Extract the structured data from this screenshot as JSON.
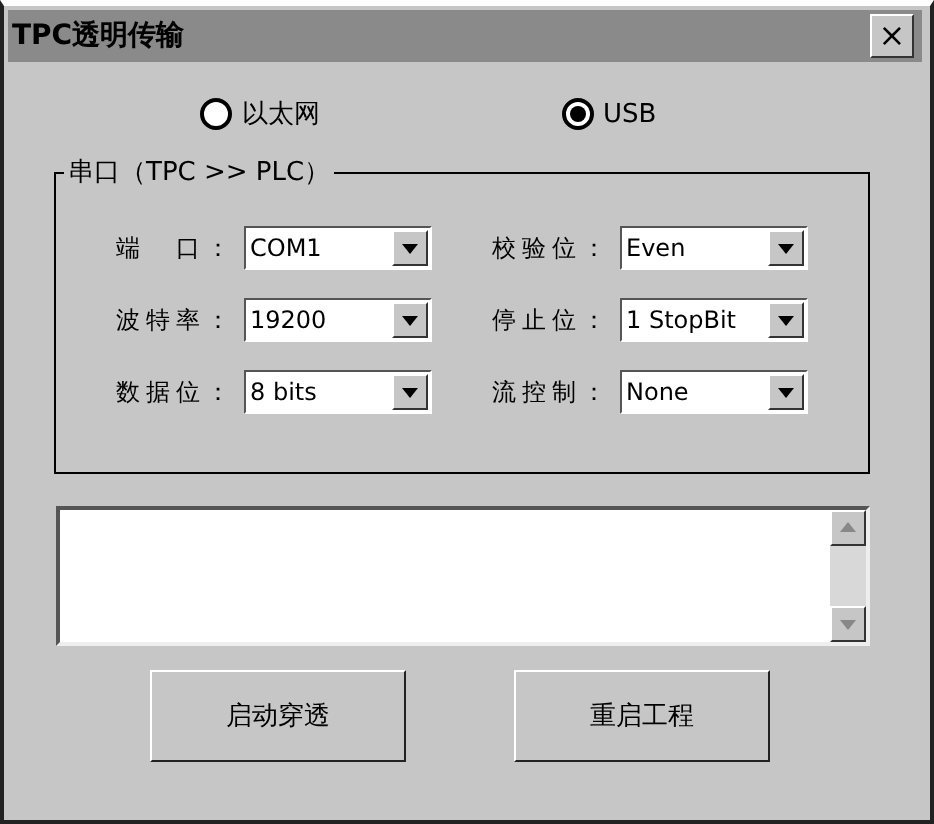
{
  "window": {
    "title": "TPC透明传输",
    "close": "×"
  },
  "connection": [
    {
      "label": "以太网",
      "selected": false
    },
    {
      "label": "USB",
      "selected": true
    }
  ],
  "group": {
    "title": "串口（TPC >> PLC）",
    "fields": [
      {
        "label": "端　口：",
        "value": "COM1"
      },
      {
        "label": "校验位：",
        "value": "Even"
      },
      {
        "label": "波特率：",
        "value": "19200"
      },
      {
        "label": "停止位：",
        "value": "1 StopBit"
      },
      {
        "label": "数据位：",
        "value": "8 bits"
      },
      {
        "label": "流控制：",
        "value": "None"
      }
    ]
  },
  "buttons": [
    "启动穿透",
    "重启工程"
  ]
}
